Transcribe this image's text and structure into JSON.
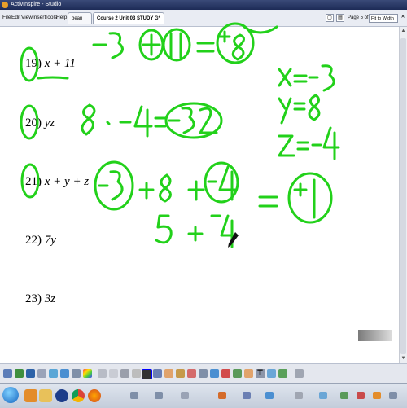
{
  "window": {
    "title": "ActivInspire - Studio"
  },
  "menu": {
    "items": [
      "File",
      "Edit",
      "View",
      "Insert",
      "Tools",
      "Help"
    ]
  },
  "tabs": [
    {
      "label": "bean jar*"
    },
    {
      "label": "Course 2 Unit 03 STUDY G*"
    }
  ],
  "page_indicator": "Page 5 of 8",
  "zoom": {
    "selected": "Fit to Width"
  },
  "problems": [
    {
      "num": "19)",
      "expr": "x + 11"
    },
    {
      "num": "20)",
      "expr": "yz"
    },
    {
      "num": "21)",
      "expr": "x + y + z"
    },
    {
      "num": "22)",
      "expr": "7y"
    },
    {
      "num": "23)",
      "expr": "3z"
    }
  ],
  "handwriting": {
    "ink_color": "#22d11a",
    "line1": "-3 + 11 = +8",
    "line2": "8 · -4 = -32",
    "line3": "-3 + 8 + -4 = +1",
    "line4": "5 + -4",
    "givens": [
      "x = -3",
      "y = 8",
      "z = -4"
    ]
  },
  "toolbar": {
    "tools": [
      "select-icon",
      "pen-icon",
      "highlighter-icon",
      "eraser-icon",
      "shape-icon",
      "text-icon",
      "undo-icon",
      "redo-icon",
      "page-browser-icon",
      "trash-icon"
    ]
  },
  "taskbar": {
    "icons": [
      "start-icon",
      "media-player-icon",
      "folder-icon",
      "activinspire-icon",
      "chrome-icon",
      "firefox-icon"
    ]
  },
  "colors": {
    "titlebar": "#1d2b57",
    "ink": "#22d11a"
  }
}
